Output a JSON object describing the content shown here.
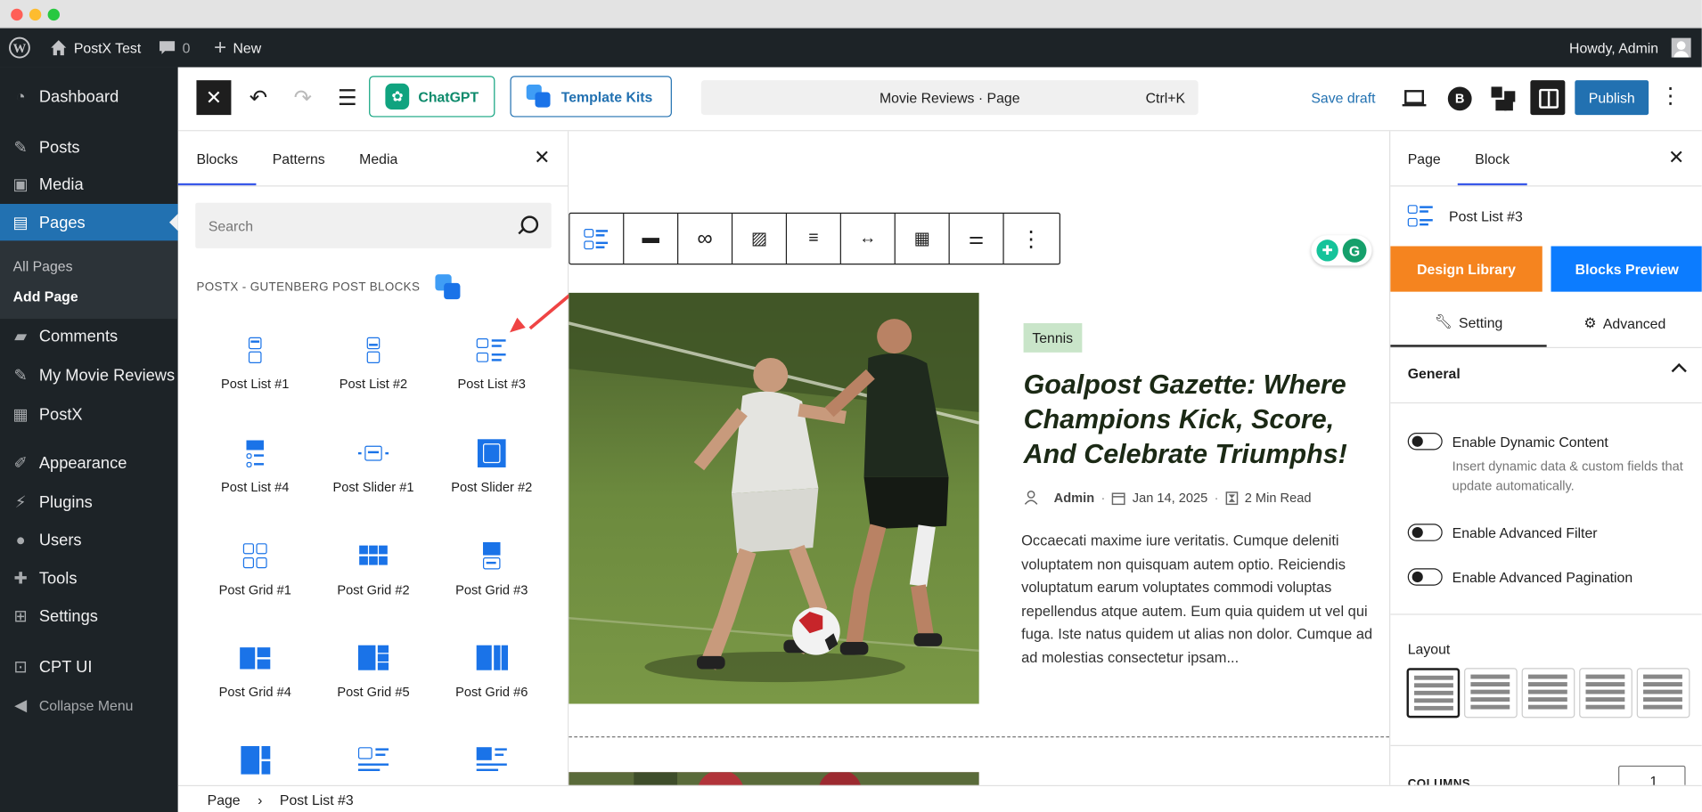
{
  "admin_bar": {
    "site_name": "PostX Test",
    "comments_count": "0",
    "new_label": "New",
    "howdy": "Howdy, Admin"
  },
  "sidebar": {
    "items": [
      {
        "label": "Dashboard",
        "icon": "dashboard-icon"
      },
      {
        "label": "Posts",
        "icon": "pin-icon"
      },
      {
        "label": "Media",
        "icon": "media-icon"
      },
      {
        "label": "Pages",
        "icon": "pages-icon"
      },
      {
        "label": "Comments",
        "icon": "comments-icon"
      },
      {
        "label": "My Movie Reviews",
        "icon": "pin-icon"
      },
      {
        "label": "PostX",
        "icon": "postx-icon"
      },
      {
        "label": "Appearance",
        "icon": "brush-icon"
      },
      {
        "label": "Plugins",
        "icon": "plugins-icon"
      },
      {
        "label": "Users",
        "icon": "users-icon"
      },
      {
        "label": "Tools",
        "icon": "tools-icon"
      },
      {
        "label": "Settings",
        "icon": "settings-icon"
      },
      {
        "label": "CPT UI",
        "icon": "cpt-icon"
      },
      {
        "label": "Collapse Menu",
        "icon": "collapse-icon"
      }
    ],
    "submenu": [
      "All Pages",
      "Add Page"
    ]
  },
  "header": {
    "chatgpt_label": "ChatGPT",
    "template_kits_label": "Template Kits",
    "document_title": "Movie Reviews · Page",
    "shortcut": "Ctrl+K",
    "save_draft": "Save draft",
    "publish": "Publish"
  },
  "inserter": {
    "tabs": [
      "Blocks",
      "Patterns",
      "Media"
    ],
    "search_placeholder": "Search",
    "category": "POSTX - GUTENBERG POST BLOCKS",
    "blocks": [
      "Post List #1",
      "Post List #2",
      "Post List #3",
      "Post List #4",
      "Post Slider #1",
      "Post Slider #2",
      "Post Grid #1",
      "Post Grid #2",
      "Post Grid #3",
      "Post Grid #4",
      "Post Grid #5",
      "Post Grid #6"
    ]
  },
  "canvas": {
    "category_badge": "Tennis",
    "post_title": "Goalpost Gazette: Where Champions Kick, Score, And Celebrate Triumphs!",
    "author": "Admin",
    "date": "Jan 14, 2025",
    "read_time": "2 Min Read",
    "excerpt": "Occaecati maxime iure veritatis. Cumque deleniti voluptatem non quisquam autem optio. Reiciendis voluptatum earum voluptates commodi voluptas repellendus atque autem. Eum quia quidem ut vel qui fuga. Iste natus quidem ut alias non dolor. Cumque ad ad molestias consectetur ipsam..."
  },
  "settings": {
    "tabs": [
      "Page",
      "Block"
    ],
    "block_name": "Post List #3",
    "design_library": "Design Library",
    "blocks_preview": "Blocks Preview",
    "setting_tab": "Setting",
    "advanced_tab": "Advanced",
    "section_title": "General",
    "toggles": [
      {
        "label": "Enable Dynamic Content",
        "help": "Insert dynamic data & custom fields that update automatically."
      },
      {
        "label": "Enable Advanced Filter"
      },
      {
        "label": "Enable Advanced Pagination"
      }
    ],
    "layout_label": "Layout",
    "columns_label": "COLUMNS",
    "columns_value": "1"
  },
  "breadcrumb": [
    "Page",
    "Post List #3"
  ],
  "colors": {
    "wp_dark": "#1d2327",
    "wp_blue": "#2271b1",
    "postx_blue": "#1a73e8",
    "orange": "#f5841f",
    "preview_blue": "#0c7cff"
  }
}
